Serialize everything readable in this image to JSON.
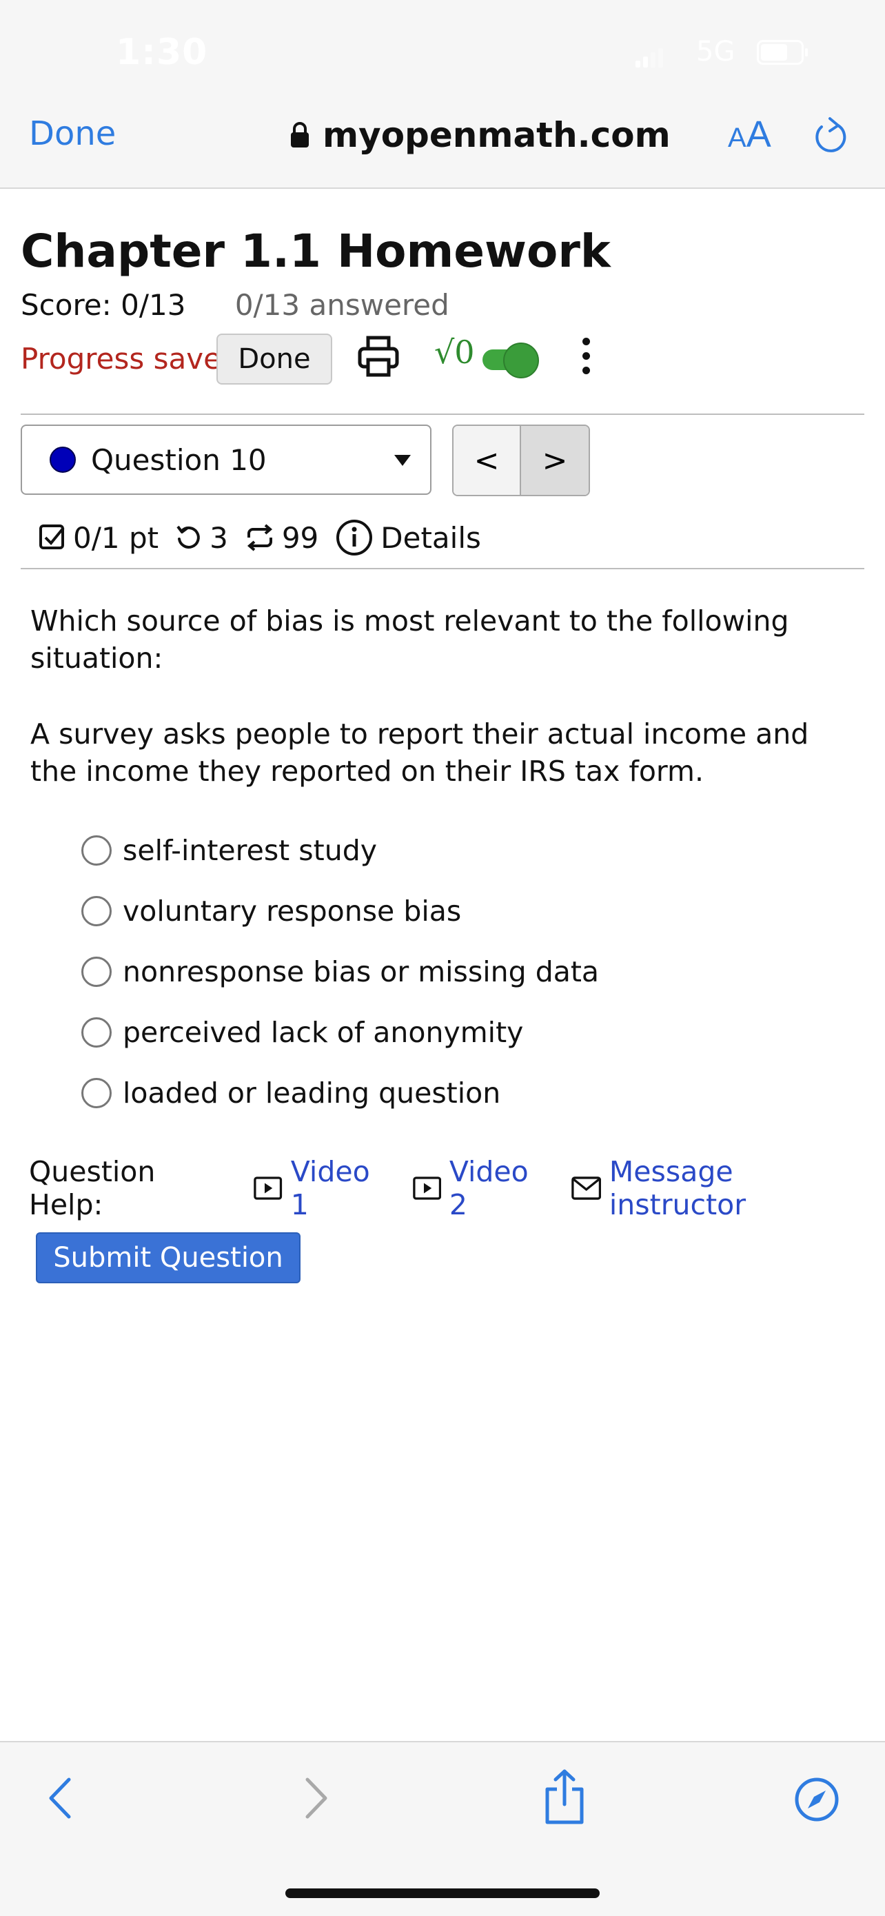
{
  "status_bar": {
    "time": "1:30",
    "network": "5G"
  },
  "browser": {
    "done_label": "Done",
    "url": "myopenmath.com",
    "text_size_small": "A",
    "text_size_large": "A",
    "accent_color": "#2f7ce0"
  },
  "assignment": {
    "title": "Chapter 1.1 Homework",
    "score": "Score: 0/13",
    "answered": "0/13 answered",
    "progress_status": "Progress saved",
    "done_button": "Done",
    "math_toggle_label": "√0",
    "math_toggle_on": true
  },
  "question_nav": {
    "selected_question": "Question 10",
    "prev_label": "<",
    "next_label": ">"
  },
  "question_meta": {
    "points": "0/1 pt",
    "retries": "3",
    "regens": "99",
    "details_label": "Details"
  },
  "question": {
    "prompt": "Which source of bias is most relevant to the following situation:",
    "scenario": "A survey asks people to report their actual income and the income they reported on their IRS tax form.",
    "options": [
      "self-interest study",
      "voluntary response bias",
      "nonresponse bias or missing data",
      "perceived lack of anonymity",
      "loaded or leading question"
    ]
  },
  "help": {
    "label": "Question Help:",
    "video1": "Video 1",
    "video2": "Video 2",
    "message": "Message instructor"
  },
  "submit_label": "Submit Question",
  "colors": {
    "progress_saved": "#b3261e",
    "link": "#2a49c7",
    "submit_bg": "#3a72d6",
    "toggle_green": "#3fa63f"
  }
}
